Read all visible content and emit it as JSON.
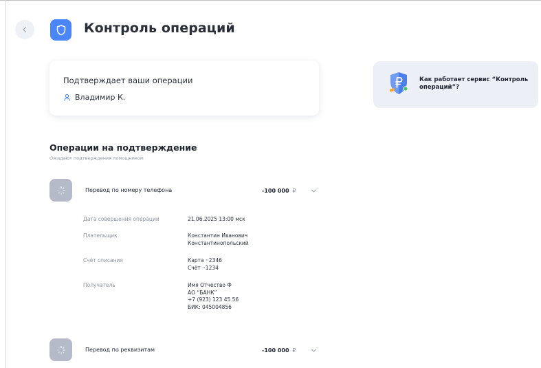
{
  "header": {
    "title": "Контроль операций"
  },
  "approver": {
    "title": "Подтверждает ваши операции",
    "name": "Владимир К."
  },
  "info_card": {
    "text": "Как работает сервис “Контроль операций”?"
  },
  "operations_section": {
    "title": "Операции на подтверждение",
    "subtitle": "Ожидают подтверждения помощником"
  },
  "operations": [
    {
      "name": "Перевод по номеру телефона",
      "amount": "-100 000",
      "currency": "₽",
      "expanded": true,
      "details": {
        "date_label": "Дата совершения операции",
        "date_value": "21.06.2025 13:00 мск",
        "payer_label": "Плательщик",
        "payer_line1": "Константин Иванович",
        "payer_line2": "Константинопольский",
        "account_label": "Счёт списания",
        "account_line1": "Карта ··2346",
        "account_line2": "Счёт ··1234",
        "recipient_label": "Получатель",
        "recipient_line1": "Имя Отчество Ф",
        "recipient_line2": "АО  “БАНК”",
        "recipient_line3": "+7 (923) 123 45 56",
        "recipient_line4": "БИК: 045004856"
      }
    },
    {
      "name": "Перевод по реквизитам",
      "amount": "-100 000",
      "currency": "₽",
      "expanded": false
    }
  ],
  "colors": {
    "accent": "#4a86f7",
    "card_bg": "#eceff6",
    "op_icon_bg": "#b5bac8",
    "muted_text": "#8a909c"
  },
  "icons": {
    "back": "chevron-left-icon",
    "title": "shield-icon",
    "approver": "person-icon",
    "info": "shield-ruble-icon",
    "operation": "loading-spinner-icon",
    "expand": "chevron-down-icon"
  }
}
